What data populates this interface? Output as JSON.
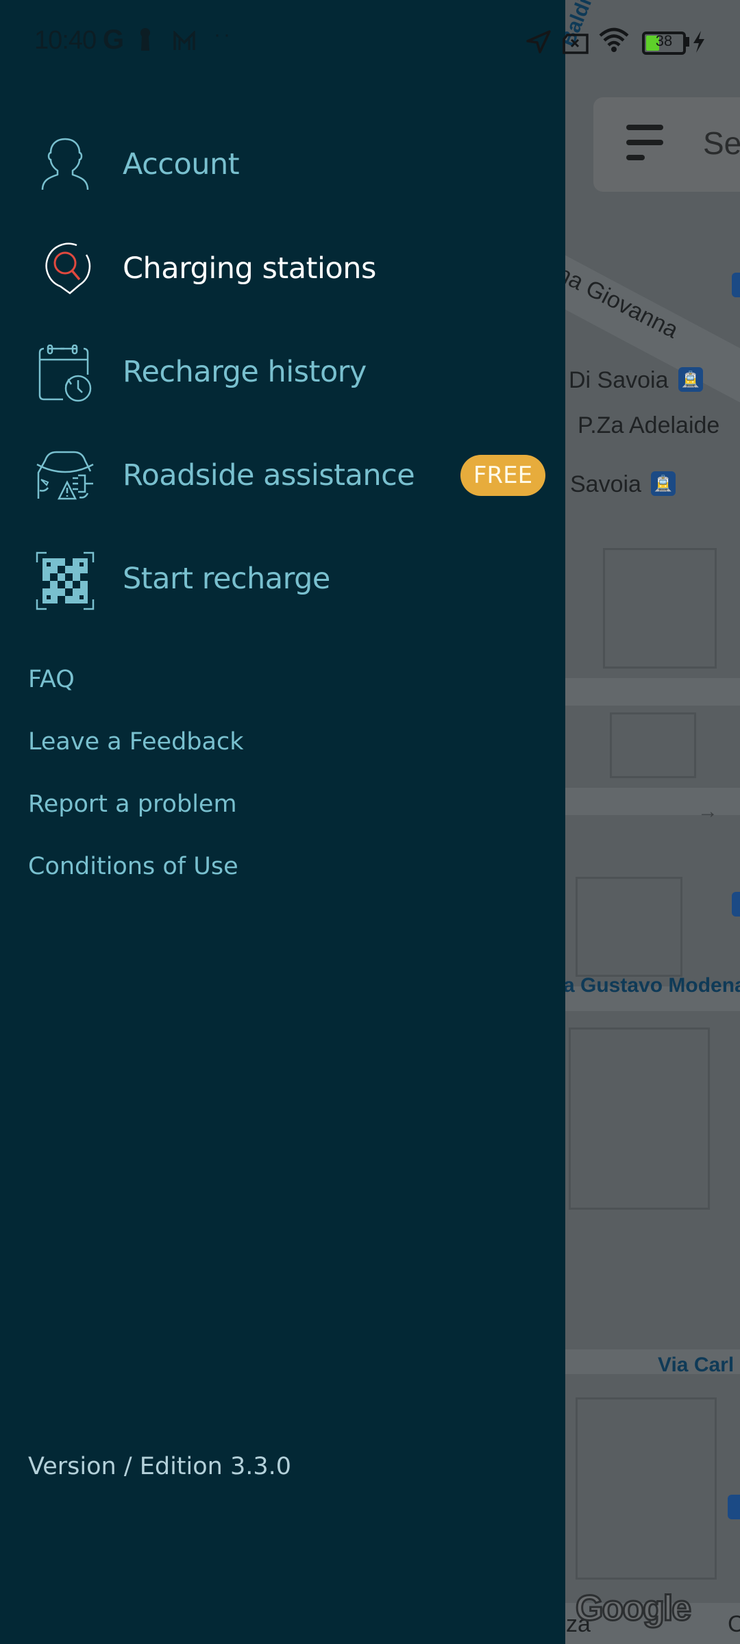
{
  "status_bar": {
    "time": "10:40",
    "notification_icons": [
      "google-icon",
      "keyhole-icon",
      "gmail-icon",
      "more-dots-icon"
    ],
    "system_icons": [
      "location-arrow-icon",
      "no-sim-icon",
      "wifi-icon",
      "battery-icon",
      "charging-bolt-icon"
    ],
    "battery_level": "38",
    "battery_percent": 38,
    "battery_color": "#5ed02a"
  },
  "drawer": {
    "background_color": "#032835",
    "primary_items": [
      {
        "label": "Account",
        "icon": "user-icon",
        "active": false
      },
      {
        "label": "Charging stations",
        "icon": "map-pin-search-icon",
        "active": true
      },
      {
        "label": "Recharge history",
        "icon": "calendar-history-icon",
        "active": false
      },
      {
        "label": "Roadside assistance",
        "icon": "car-warning-plug-icon",
        "active": false,
        "badge": "FREE"
      },
      {
        "label": "Start recharge",
        "icon": "qr-code-scan-icon",
        "active": false
      }
    ],
    "secondary_links": [
      {
        "label": "FAQ"
      },
      {
        "label": "Leave a Feedback"
      },
      {
        "label": "Report a problem"
      },
      {
        "label": "Conditions of Use"
      }
    ],
    "version": "Version / Edition 3.3.0",
    "accent_color": "#79c0cf",
    "badge_color": "#e7ac3c"
  },
  "map": {
    "search_placeholder": "Sea",
    "labels": [
      {
        "text": "Baldissero",
        "style": "blue"
      },
      {
        "text": "na Giovanna",
        "style": "dark"
      },
      {
        "text": "Di Savoia",
        "style": "dark"
      },
      {
        "text": "P.Za Adelaide",
        "style": "dark"
      },
      {
        "text": "Savoia",
        "style": "dark"
      },
      {
        "text": "a Gustavo Modena",
        "style": "blue"
      },
      {
        "text": "Via Carl",
        "style": "blue"
      },
      {
        "text": "za",
        "style": "dark"
      },
      {
        "text": "C",
        "style": "dark"
      }
    ],
    "attribution": "Google"
  }
}
